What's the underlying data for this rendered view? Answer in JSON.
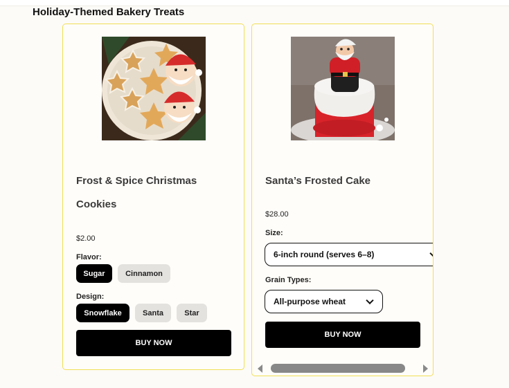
{
  "section_title": "Holiday-Themed Bakery Treats",
  "products": [
    {
      "name_line1": "Frost & Spice Christmas",
      "name_line2": "Cookies",
      "image_alt": "gingerbread cookies with snowflakes, stars and Santa faces",
      "price": "$2.00",
      "flavor_label": "Flavor:",
      "flavors": [
        "Sugar",
        "Cinnamon"
      ],
      "selected_flavor": "Sugar",
      "design_label": "Design:",
      "designs": [
        "Snowflake",
        "Santa",
        "Star"
      ],
      "selected_design": "Snowflake",
      "buy_label": "BUY NOW"
    },
    {
      "name": "Santa’s Frosted Cake",
      "image_alt": "white frosted cake topped with a Santa figure",
      "price": "$28.00",
      "size_label": "Size:",
      "size_value": "6-inch round (serves 6–8)",
      "grain_label": "Grain Types:",
      "grain_value": "All-purpose wheat",
      "buy_label": "BUY NOW"
    }
  ],
  "icons": {
    "dropdown": "chevron-down-icon",
    "scroll_left": "arrow-left-icon",
    "scroll_right": "arrow-right-icon"
  },
  "colors": {
    "card_border": "#f0df55",
    "selected_chip": "#000000",
    "unselected_chip": "#e4e2df",
    "button": "#000000"
  }
}
